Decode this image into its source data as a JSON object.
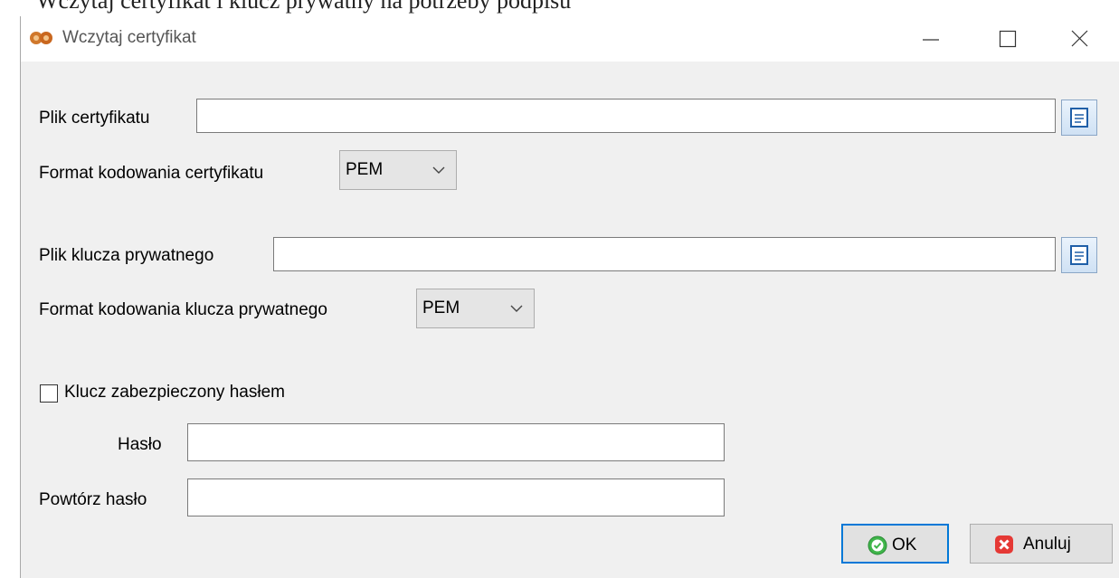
{
  "background_text": "Wczytaj certyfikat i klucz prywatny na potrzeby podpisu",
  "window": {
    "title": "Wczytaj certyfikat",
    "controls": {
      "minimize_icon": "minimize-icon",
      "maximize_icon": "maximize-icon",
      "close_icon": "close-icon"
    }
  },
  "form": {
    "cert_file_label": "Plik certyfikatu",
    "cert_file_value": "",
    "cert_format_label": "Format kodowania certyfikatu",
    "cert_format_value": "PEM",
    "key_file_label": "Plik klucza prywatnego",
    "key_file_value": "",
    "key_format_label": "Format kodowania klucza prywatnego",
    "key_format_value": "PEM",
    "password_protected_label": "Klucz zabezpieczony hasłem",
    "password_protected_checked": false,
    "password_label": "Hasło",
    "password_value": "",
    "password_repeat_label": "Powtórz hasło",
    "password_repeat_value": ""
  },
  "buttons": {
    "ok_label": "OK",
    "cancel_label": "Anuluj"
  },
  "colors": {
    "accent": "#0078d7",
    "ok_icon": "#3fb54a",
    "cancel_icon": "#e53935"
  }
}
